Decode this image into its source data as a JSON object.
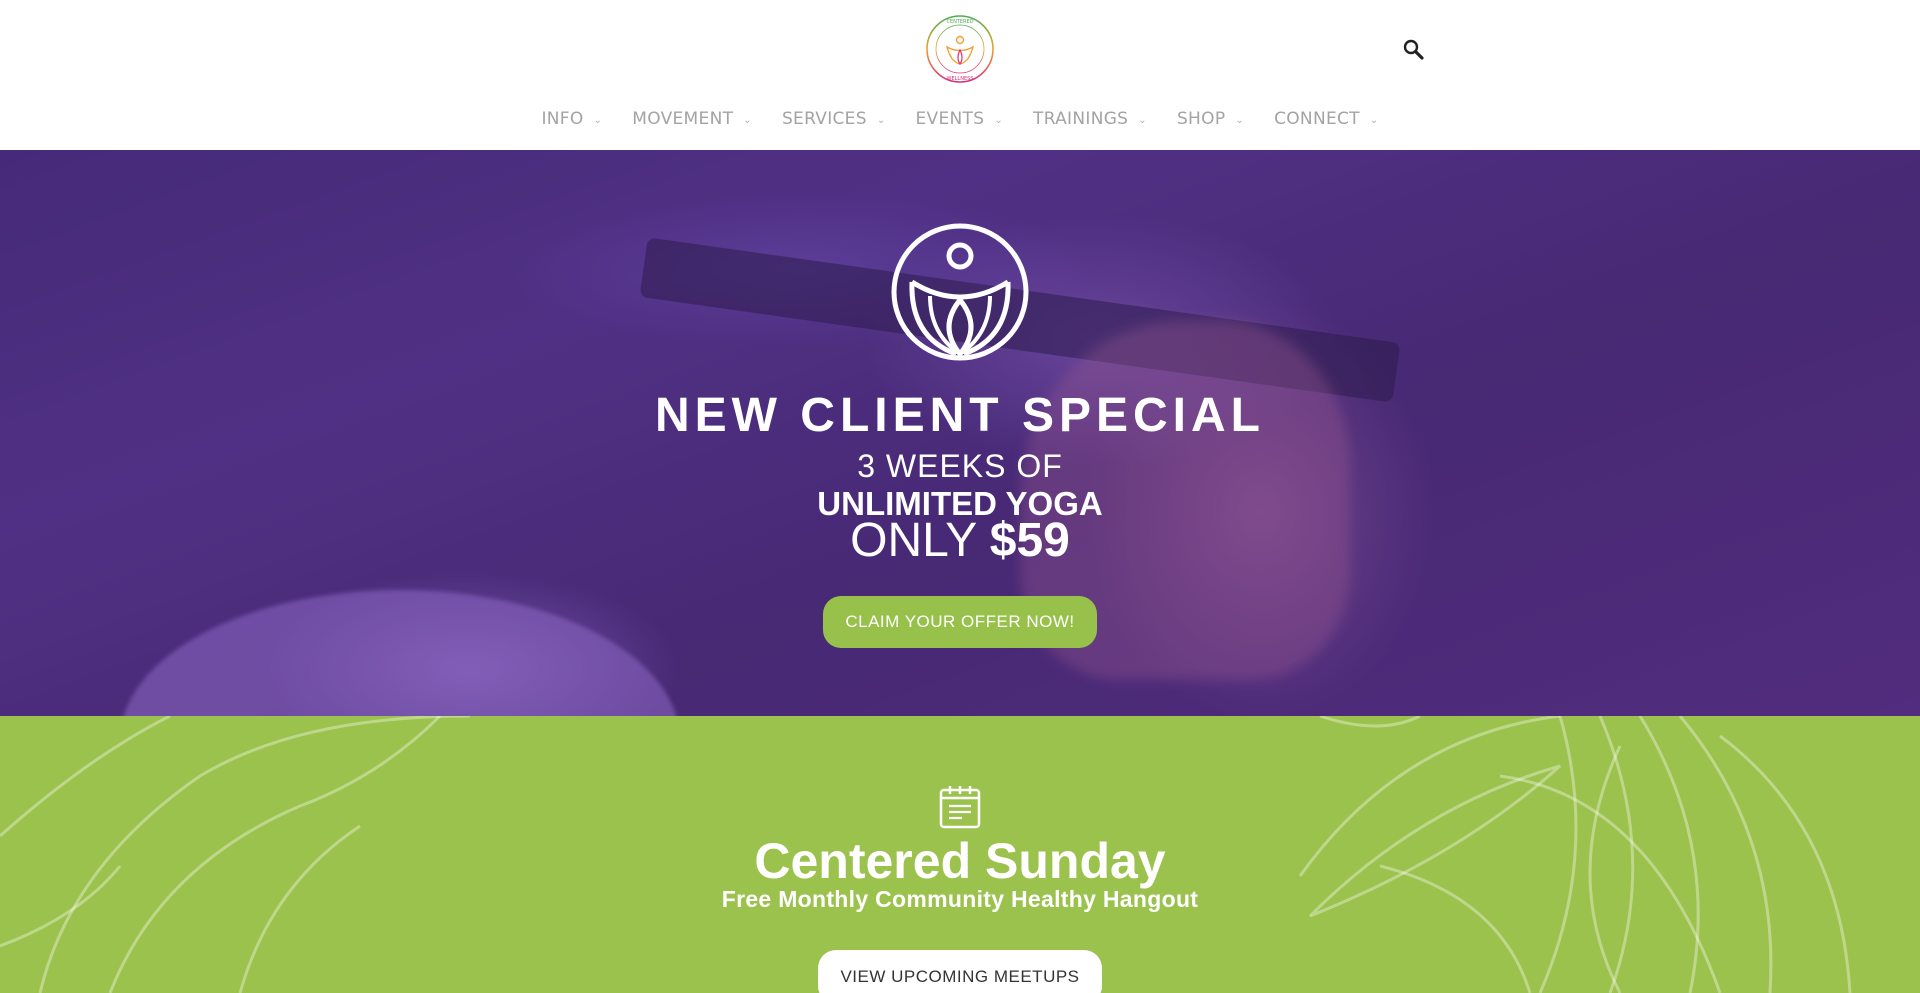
{
  "header": {
    "logo_alt": "Centered Wellness",
    "logo_text_top": "CENTERED",
    "logo_text_bottom": "WELLNESS",
    "search_icon": "search-icon"
  },
  "nav": {
    "items": [
      {
        "label": "INFO"
      },
      {
        "label": "MOVEMENT"
      },
      {
        "label": "SERVICES"
      },
      {
        "label": "EVENTS"
      },
      {
        "label": "TRAININGS"
      },
      {
        "label": "SHOP"
      },
      {
        "label": "CONNECT"
      }
    ],
    "chevron": "⌄"
  },
  "hero": {
    "title": "NEW CLIENT SPECIAL",
    "line1": "3 WEEKS OF",
    "line2": "UNLIMITED YOGA",
    "line3_prefix": "ONLY ",
    "line3_price": "$59",
    "cta_label": "CLAIM YOUR OFFER NOW!"
  },
  "community": {
    "title": "Centered Sunday",
    "subtitle": "Free Monthly Community Healthy Hangout",
    "button_label": "VIEW UPCOMING MEETUPS"
  },
  "colors": {
    "accent_green": "#9bc24d",
    "cta_green": "#97c14a",
    "hero_purple": "#4b2c7a",
    "nav_text": "#a3a3a3"
  }
}
